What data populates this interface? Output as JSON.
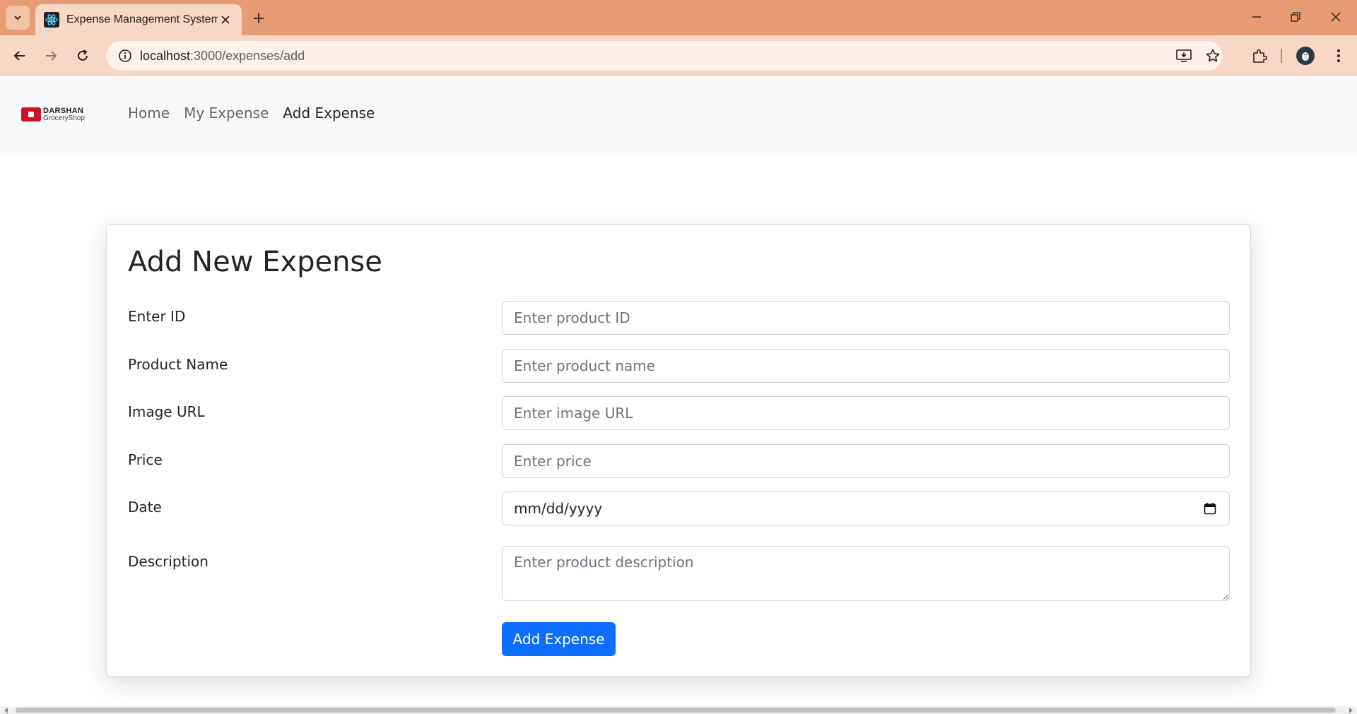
{
  "browser": {
    "tab_title": "Expense Management System",
    "url_host": "localhost",
    "url_path": ":3000/expenses/add"
  },
  "navbar": {
    "brand_line1": "DARSHAN",
    "brand_line2": "GroceryShop",
    "links": [
      "Home",
      "My Expense",
      "Add Expense"
    ],
    "active_link": "Add Expense"
  },
  "form": {
    "title": "Add New Expense",
    "fields": [
      {
        "label": "Enter ID",
        "placeholder": "Enter product ID",
        "value": ""
      },
      {
        "label": "Product Name",
        "placeholder": "Enter product name",
        "value": ""
      },
      {
        "label": "Image URL",
        "placeholder": "Enter image URL",
        "value": ""
      },
      {
        "label": "Price",
        "placeholder": "Enter price",
        "value": ""
      },
      {
        "label": "Date",
        "placeholder": "mm/dd/yyyy",
        "value": ""
      },
      {
        "label": "Description",
        "placeholder": "Enter product description",
        "value": ""
      }
    ],
    "submit_label": "Add Expense"
  },
  "colors": {
    "tabbar": "#e99b73",
    "toolbar": "#f7d8c6",
    "primary_button": "#0d6efd",
    "navbar_bg": "#f8f9fa"
  },
  "icons": [
    "tab-search-icon",
    "react-favicon-icon",
    "close-icon",
    "plus-icon",
    "minimize-icon",
    "restore-icon",
    "back-icon",
    "forward-icon",
    "reload-icon",
    "info-icon",
    "install-app-icon",
    "star-icon",
    "extensions-icon",
    "profile-avatar-icon",
    "more-menu-icon",
    "calendar-icon"
  ]
}
